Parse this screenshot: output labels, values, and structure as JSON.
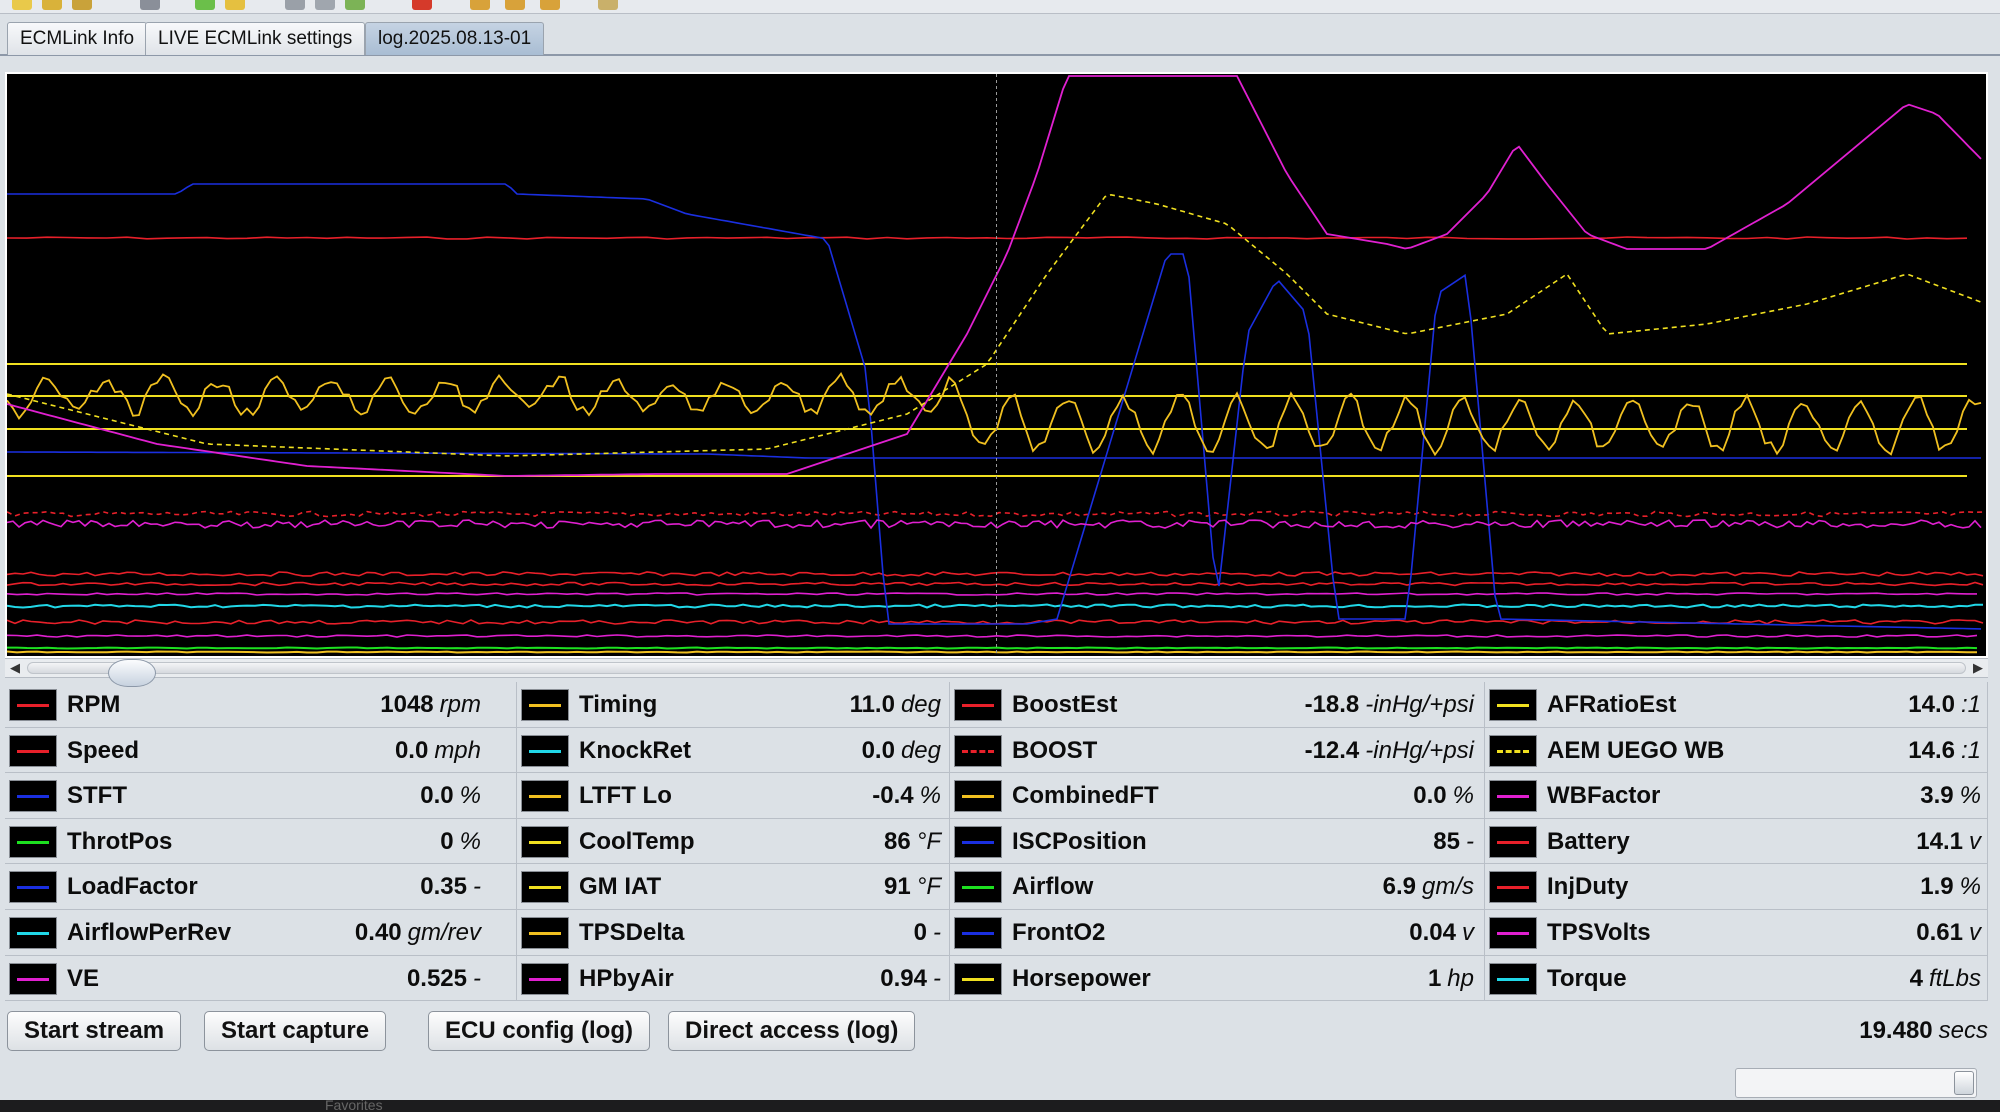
{
  "tabs": [
    {
      "label": "ECMLink Info",
      "active": false
    },
    {
      "label": "LIVE ECMLink settings",
      "active": false
    },
    {
      "label": "log.2025.08.13-01",
      "active": true
    }
  ],
  "parameters": [
    [
      {
        "name": "RPM",
        "value": "1048",
        "unit": "rpm",
        "color": "#e8202a",
        "style": "solid"
      },
      {
        "name": "Speed",
        "value": "0.0",
        "unit": "mph",
        "color": "#e8202a",
        "style": "solid"
      },
      {
        "name": "STFT",
        "value": "0.0",
        "unit": "%",
        "color": "#1a2fe0",
        "style": "solid"
      },
      {
        "name": "ThrotPos",
        "value": "0",
        "unit": "%",
        "color": "#1de020",
        "style": "solid"
      },
      {
        "name": "LoadFactor",
        "value": "0.35",
        "unit": "-",
        "color": "#1a2fe0",
        "style": "solid"
      },
      {
        "name": "AirflowPerRev",
        "value": "0.40",
        "unit": "gm/rev",
        "color": "#21d8e8",
        "style": "solid"
      },
      {
        "name": "VE",
        "value": "0.525",
        "unit": "-",
        "color": "#e020d0",
        "style": "solid"
      }
    ],
    [
      {
        "name": "Timing",
        "value": "11.0",
        "unit": "deg",
        "color": "#f0c020",
        "style": "solid"
      },
      {
        "name": "KnockRet",
        "value": "0.0",
        "unit": "deg",
        "color": "#21d8e8",
        "style": "solid"
      },
      {
        "name": "LTFT Lo",
        "value": "-0.4",
        "unit": "%",
        "color": "#f0c020",
        "style": "solid"
      },
      {
        "name": "CoolTemp",
        "value": "86",
        "unit": "°F",
        "color": "#f0e020",
        "style": "solid"
      },
      {
        "name": "GM IAT",
        "value": "91",
        "unit": "°F",
        "color": "#f0e020",
        "style": "solid"
      },
      {
        "name": "TPSDelta",
        "value": "0",
        "unit": "-",
        "color": "#f0c020",
        "style": "solid"
      },
      {
        "name": "HPbyAir",
        "value": "0.94",
        "unit": "-",
        "color": "#e020d0",
        "style": "solid"
      }
    ],
    [
      {
        "name": "BoostEst",
        "value": "-18.8",
        "unit": "-inHg/+psi",
        "color": "#e8202a",
        "style": "solid"
      },
      {
        "name": "BOOST",
        "value": "-12.4",
        "unit": "-inHg/+psi",
        "color": "#e8202a",
        "style": "dashed"
      },
      {
        "name": "CombinedFT",
        "value": "0.0",
        "unit": "%",
        "color": "#f0c020",
        "style": "solid"
      },
      {
        "name": "ISCPosition",
        "value": "85",
        "unit": "-",
        "color": "#1a2fe0",
        "style": "solid"
      },
      {
        "name": "Airflow",
        "value": "6.9",
        "unit": "gm/s",
        "color": "#1de020",
        "style": "solid"
      },
      {
        "name": "FrontO2",
        "value": "0.04",
        "unit": "v",
        "color": "#1a2fe0",
        "style": "solid"
      },
      {
        "name": "Horsepower",
        "value": "1",
        "unit": "hp",
        "color": "#f0e020",
        "style": "solid"
      }
    ],
    [
      {
        "name": "AFRatioEst",
        "value": "14.0",
        "unit": ":1",
        "color": "#f0e020",
        "style": "solid"
      },
      {
        "name": "AEM UEGO WB",
        "value": "14.6",
        "unit": ":1",
        "color": "#f0e020",
        "style": "dashed"
      },
      {
        "name": "WBFactor",
        "value": "3.9",
        "unit": "%",
        "color": "#e020d0",
        "style": "solid"
      },
      {
        "name": "Battery",
        "value": "14.1",
        "unit": "v",
        "color": "#e8202a",
        "style": "solid"
      },
      {
        "name": "InjDuty",
        "value": "1.9",
        "unit": "%",
        "color": "#e8202a",
        "style": "solid"
      },
      {
        "name": "TPSVolts",
        "value": "0.61",
        "unit": "v",
        "color": "#e020d0",
        "style": "solid"
      },
      {
        "name": "Torque",
        "value": "4",
        "unit": "ftLbs",
        "color": "#21d8e8",
        "style": "solid"
      }
    ]
  ],
  "buttons": {
    "start_stream": "Start stream",
    "start_capture": "Start capture",
    "ecu_config": "ECU config (log)",
    "direct_access": "Direct access (log)"
  },
  "elapsed": {
    "value": "19.480",
    "unit": "secs"
  },
  "dock_label": "Favorites",
  "chart": {
    "background": "#000000",
    "cursor_fraction": 0.5
  }
}
